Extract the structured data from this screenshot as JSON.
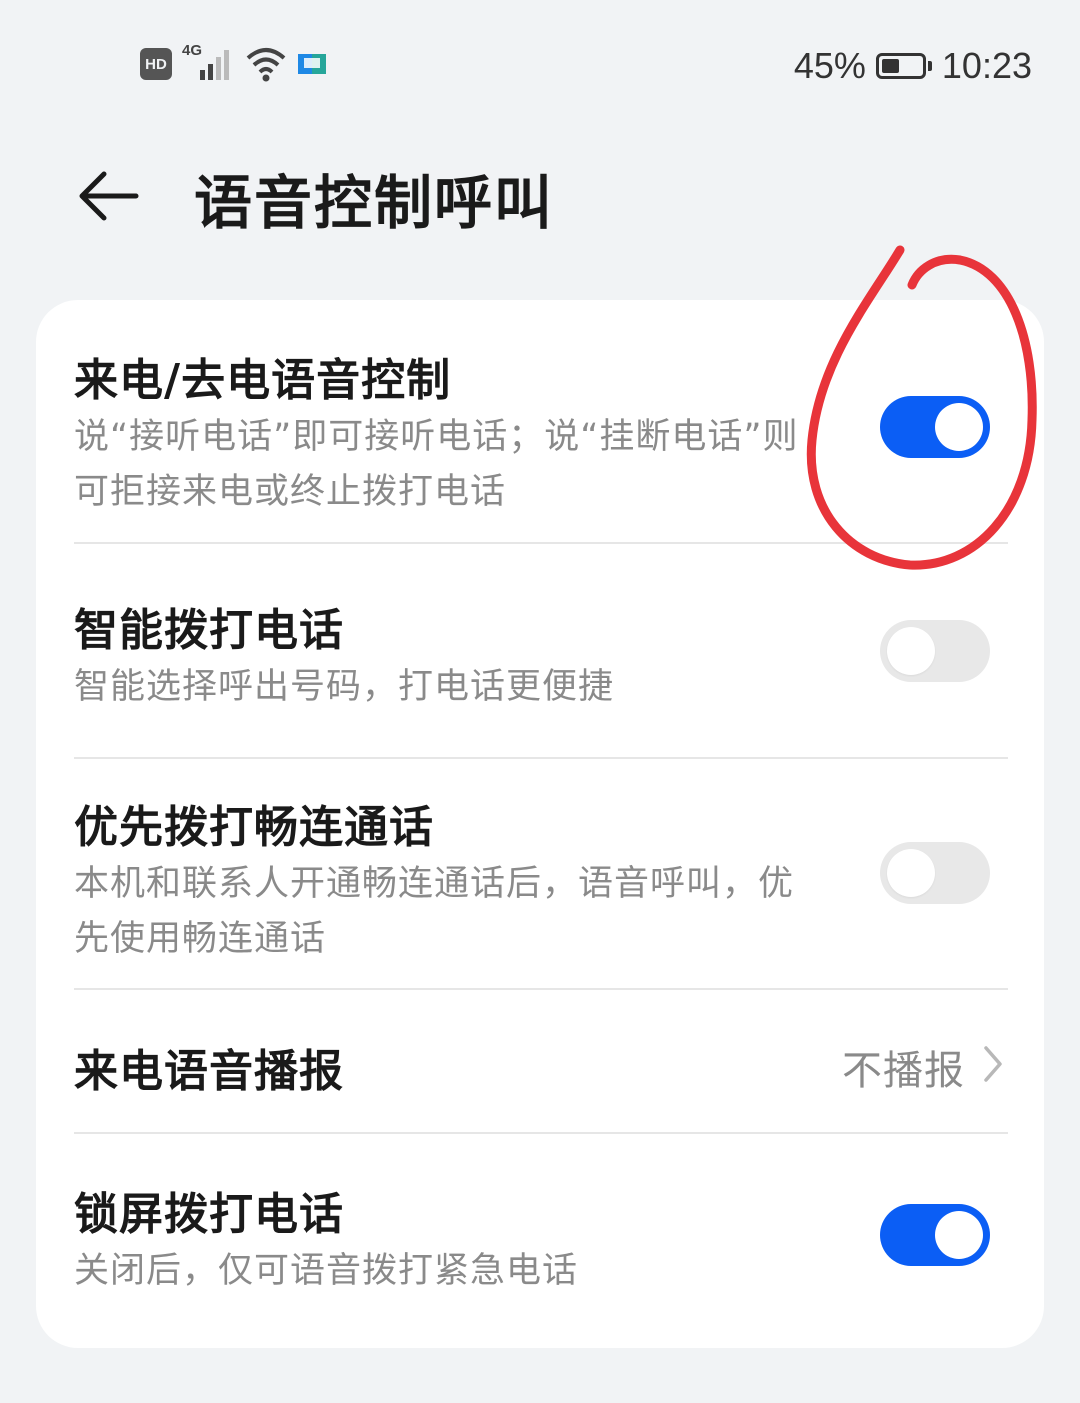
{
  "status_bar": {
    "hd_label": "HD",
    "network_label": "4G",
    "battery_percent_text": "45%",
    "battery_level": 0.45,
    "time": "10:23"
  },
  "header": {
    "title": "语音控制呼叫",
    "back_icon": "back-arrow-icon"
  },
  "settings": [
    {
      "title": "来电/去电语音控制",
      "desc": "说“接听电话”即可接听电话；说“挂断电话”则可拒接来电或终止拨打电话",
      "toggle": true
    },
    {
      "title": "智能拨打电话",
      "desc": "智能选择呼出号码，打电话更便捷",
      "toggle": false
    },
    {
      "title": "优先拨打畅连通话",
      "desc": "本机和联系人开通畅连通话后，语音呼叫，优先使用畅连通话",
      "toggle": false
    },
    {
      "title": "来电语音播报",
      "value": "不播报",
      "icon": "chevron-right-icon"
    },
    {
      "title": "锁屏拨打电话",
      "desc": "关闭后，仅可语音拨打紧急电话",
      "toggle": true
    }
  ],
  "colors": {
    "accent": "#0b5ef5",
    "background": "#f1f3f5",
    "card": "#ffffff",
    "annotation": "#e8343a"
  }
}
